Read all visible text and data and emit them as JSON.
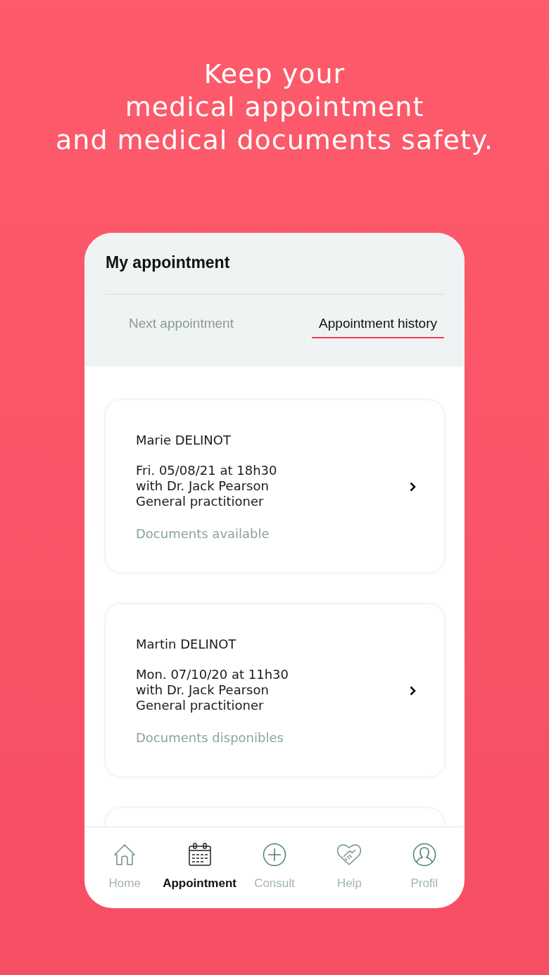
{
  "headline": [
    "Keep your",
    "medical appointment",
    "and medical documents safety."
  ],
  "screen": {
    "title": "My appointment",
    "tabs": [
      {
        "label": "Next appointment",
        "selected": false
      },
      {
        "label": "Appointment history",
        "selected": true
      }
    ],
    "appointments": [
      {
        "patient": "Marie DELINOT",
        "date": "Fri. 05/08/21 at 18h30",
        "doctor": "with Dr. Jack Pearson",
        "specialty": "General practitioner",
        "documents": "Documents available"
      },
      {
        "patient": "Martin DELINOT",
        "date": "Mon. 07/10/20 at 11h30",
        "doctor": "with Dr. Jack Pearson",
        "specialty": "General practitioner",
        "documents": "Documents disponibles"
      }
    ],
    "nav": [
      {
        "label": "Home",
        "selected": false
      },
      {
        "label": "Appointment",
        "selected": true
      },
      {
        "label": "Consult",
        "selected": false
      },
      {
        "label": "Help",
        "selected": false
      },
      {
        "label": "Profil",
        "selected": false
      }
    ]
  }
}
